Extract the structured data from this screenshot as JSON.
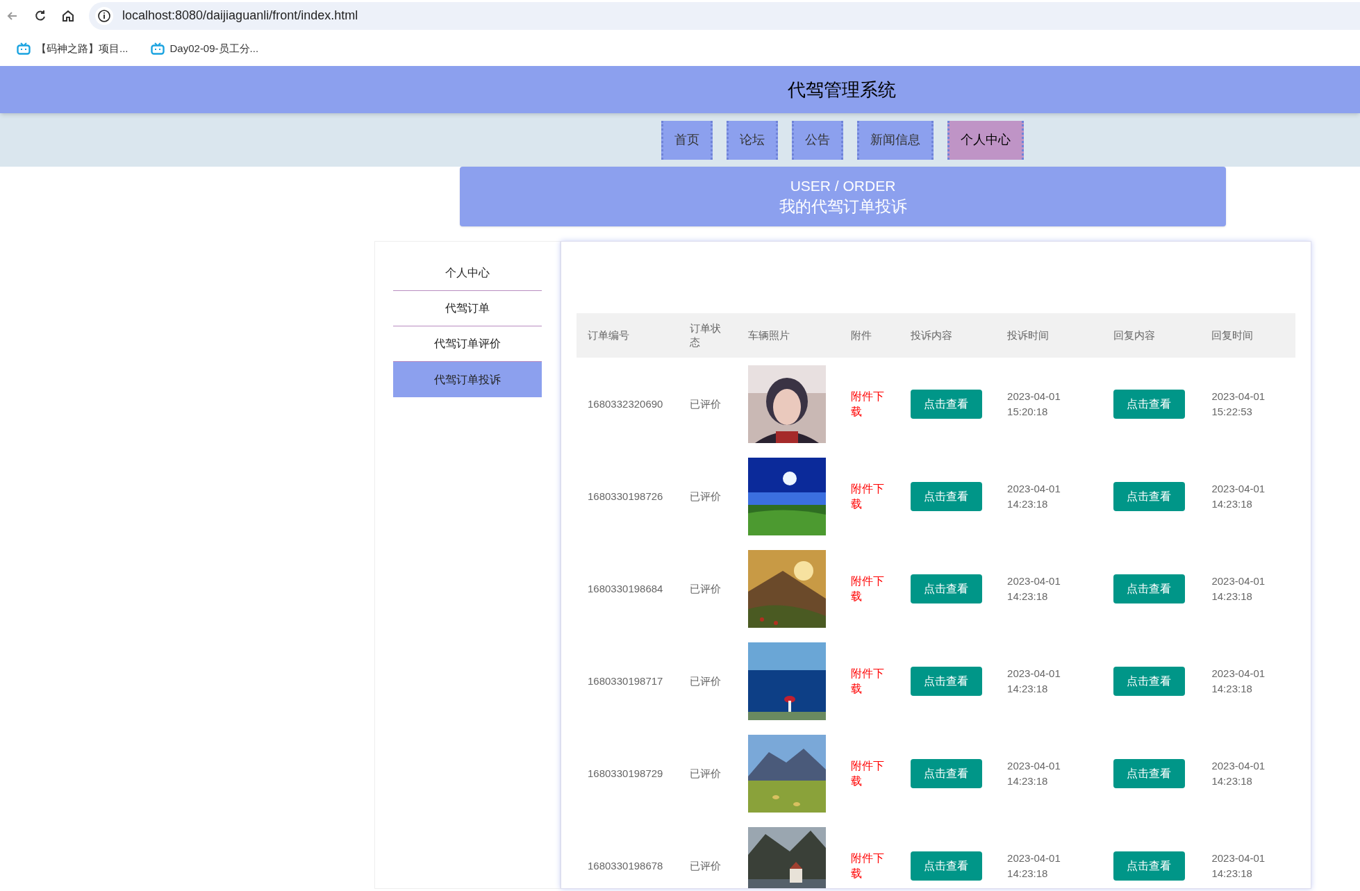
{
  "browser": {
    "url": "localhost:8080/daijiaguanli/front/index.html",
    "bookmarks": [
      "【码神之路】项目...",
      "Day02-09-员工分..."
    ]
  },
  "site_title": "代驾管理系统",
  "nav": [
    {
      "label": "首页",
      "selected": false
    },
    {
      "label": "论坛",
      "selected": false
    },
    {
      "label": "公告",
      "selected": false
    },
    {
      "label": "新闻信息",
      "selected": false
    },
    {
      "label": "个人中心",
      "selected": true
    }
  ],
  "banner": {
    "path": "USER / ORDER",
    "title": "我的代驾订单投诉"
  },
  "sidebar": [
    {
      "label": "个人中心",
      "selected": false
    },
    {
      "label": "代驾订单",
      "selected": false
    },
    {
      "label": "代驾订单评价",
      "selected": false
    },
    {
      "label": "代驾订单投诉",
      "selected": true
    }
  ],
  "table": {
    "columns": [
      "订单编号",
      "订单状态",
      "车辆照片",
      "附件",
      "投诉内容",
      "投诉时间",
      "回复内容",
      "回复时间"
    ],
    "rows": [
      {
        "order_no": "1680332320690",
        "status": "已评价",
        "attachment": "附件下载",
        "complaint": "点击查看",
        "complaint_time": "2023-04-01 15:20:18",
        "reply": "点击查看",
        "reply_time": "2023-04-01 15:22:53"
      },
      {
        "order_no": "1680330198726",
        "status": "已评价",
        "attachment": "附件下载",
        "complaint": "点击查看",
        "complaint_time": "2023-04-01 14:23:18",
        "reply": "点击查看",
        "reply_time": "2023-04-01 14:23:18"
      },
      {
        "order_no": "1680330198684",
        "status": "已评价",
        "attachment": "附件下载",
        "complaint": "点击查看",
        "complaint_time": "2023-04-01 14:23:18",
        "reply": "点击查看",
        "reply_time": "2023-04-01 14:23:18"
      },
      {
        "order_no": "1680330198717",
        "status": "已评价",
        "attachment": "附件下载",
        "complaint": "点击查看",
        "complaint_time": "2023-04-01 14:23:18",
        "reply": "点击查看",
        "reply_time": "2023-04-01 14:23:18"
      },
      {
        "order_no": "1680330198729",
        "status": "已评价",
        "attachment": "附件下载",
        "complaint": "点击查看",
        "complaint_time": "2023-04-01 14:23:18",
        "reply": "点击查看",
        "reply_time": "2023-04-01 14:23:18"
      },
      {
        "order_no": "1680330198678",
        "status": "已评价",
        "attachment": "附件下载",
        "complaint": "点击查看",
        "complaint_time": "2023-04-01 14:23:18",
        "reply": "点击查看",
        "reply_time": "2023-04-01 14:23:18"
      }
    ]
  }
}
